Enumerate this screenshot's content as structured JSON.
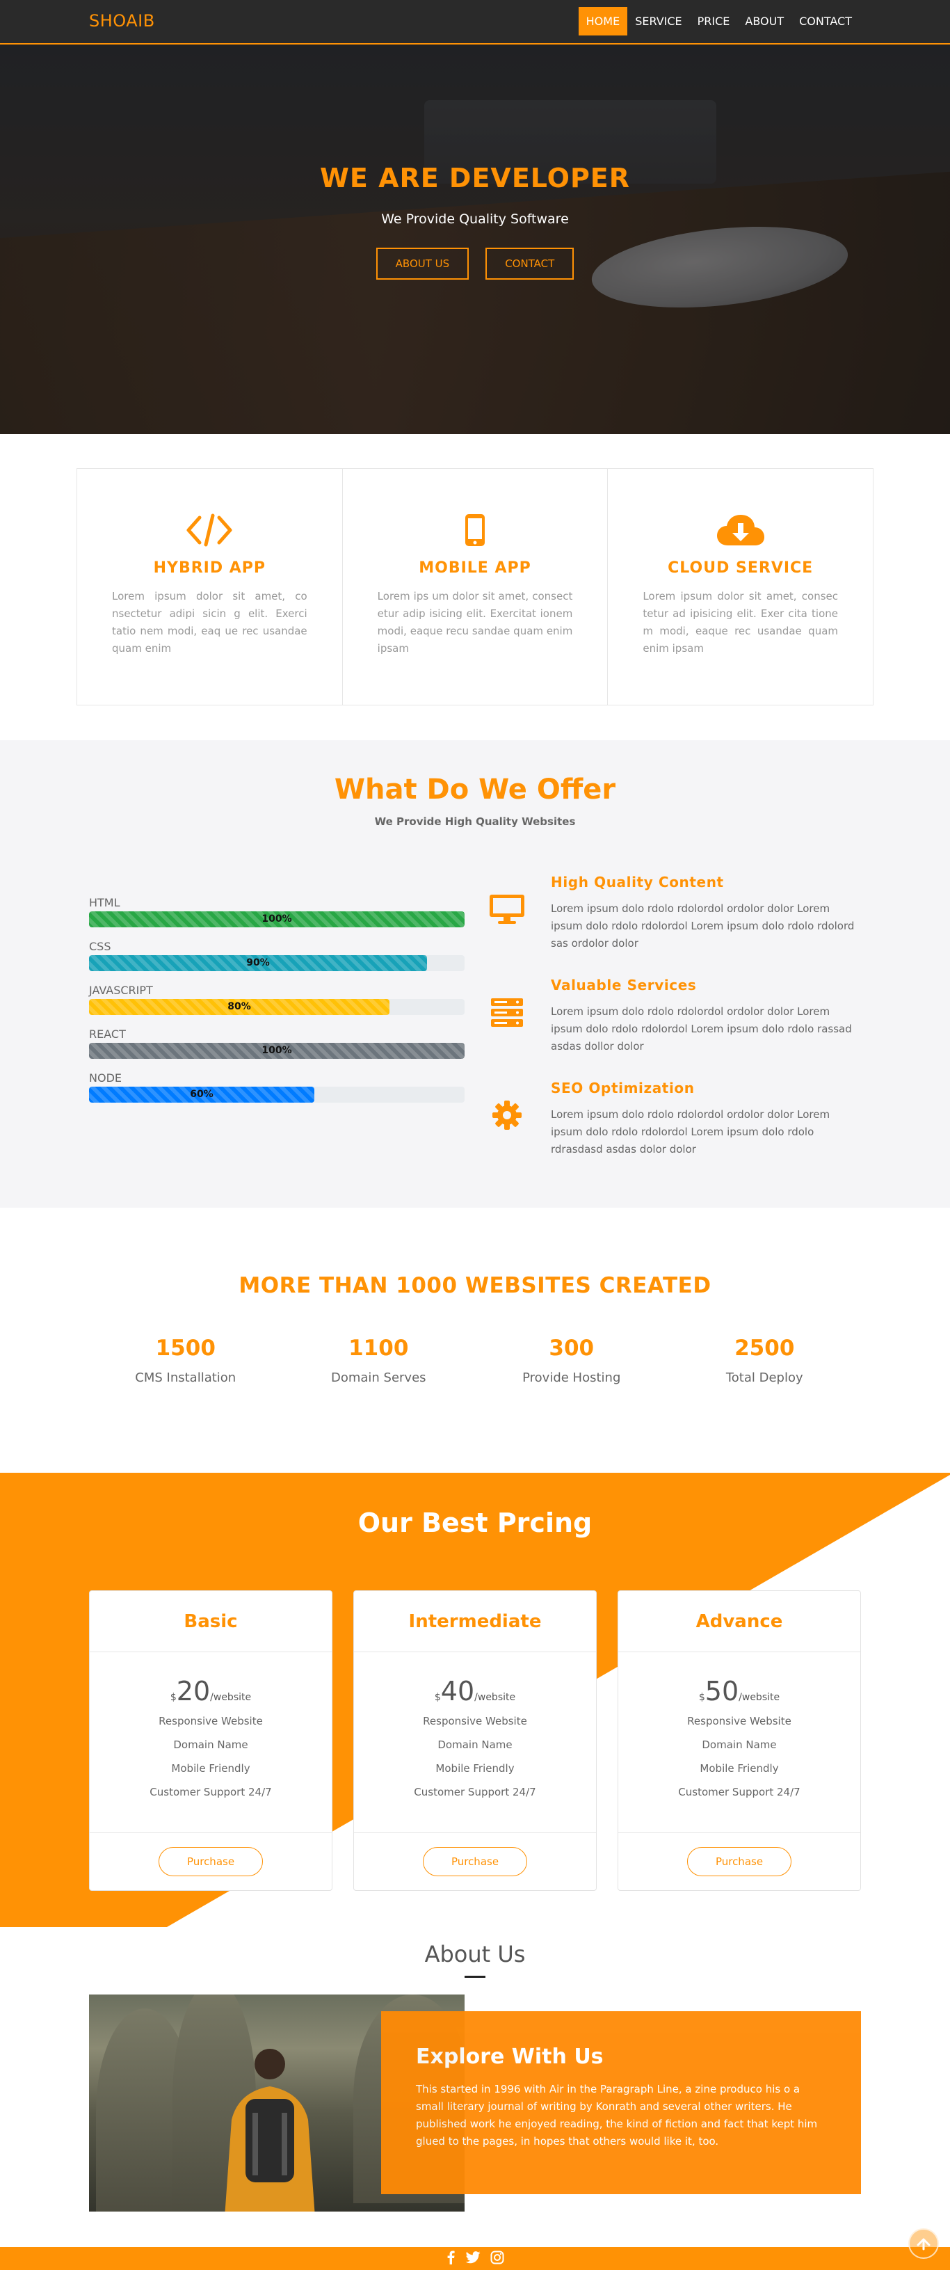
{
  "nav": {
    "brand": "SHOAIB",
    "items": [
      {
        "label": "HOME",
        "active": true
      },
      {
        "label": "SERVICE"
      },
      {
        "label": "PRICE"
      },
      {
        "label": "ABOUT"
      },
      {
        "label": "CONTACT"
      }
    ]
  },
  "hero": {
    "title": "WE ARE DEVELOPER",
    "subtitle": "We Provide Quality Software",
    "about_btn": "ABOUT US",
    "contact_btn": "CONTACT"
  },
  "services": [
    {
      "icon": "code-icon",
      "title": "HYBRID APP",
      "text": "Lorem ipsum dolor sit amet, co nsectetur adipi sicin g elit. Exerci tatio nem modi, eaq ue rec usandae quam enim"
    },
    {
      "icon": "mobile-icon",
      "title": "MOBILE APP",
      "text": "Lorem ips um dolor sit amet, consect etur adip isicing elit. Exercitat ionem modi, eaque recu sandae quam enim ipsam"
    },
    {
      "icon": "cloud-download-icon",
      "title": "CLOUD SERVICE",
      "text": "Lorem ipsum dolor sit amet, consec tetur ad ipisicing elit. Exer cita tione m modi, eaque rec usandae quam enim ipsam"
    }
  ],
  "offer": {
    "title": "What Do We Offer",
    "subtitle": "We Provide High Quality Websites",
    "skills": [
      {
        "name": "HTML",
        "percent": 100,
        "label": "100%",
        "color": "#28a745"
      },
      {
        "name": "CSS",
        "percent": 90,
        "label": "90%",
        "color": "#17a2b8"
      },
      {
        "name": "JAVASCRIPT",
        "percent": 80,
        "label": "80%",
        "color": "#ffc107"
      },
      {
        "name": "REACT",
        "percent": 100,
        "label": "100%",
        "color": "#6c757d"
      },
      {
        "name": "NODE",
        "percent": 60,
        "label": "60%",
        "color": "#007bff"
      }
    ],
    "features": [
      {
        "icon": "monitor-icon",
        "title": "High Quality Content",
        "text": "Lorem ipsum dolo rdolo rdolordol ordolor dolor Lorem ipsum dolo rdolo rdolordol Lorem ipsum dolo rdolo rdolord sas ordolor dolor"
      },
      {
        "icon": "server-icon",
        "title": "Valuable Services",
        "text": "Lorem ipsum dolo rdolo rdolordol ordolor dolor Lorem ipsum dolo rdolo rdolordol Lorem ipsum dolo rdolo rassad asdas dollor dolor"
      },
      {
        "icon": "gear-icon",
        "title": "SEO Optimization",
        "text": "Lorem ipsum dolo rdolo rdolordol ordolor dolor Lorem ipsum dolo rdolo rdolordol Lorem ipsum dolo rdolo rdrasdasd asdas dolor dolor"
      }
    ]
  },
  "stats": {
    "title": "MORE THAN 1000 WEBSITES CREATED",
    "items": [
      {
        "number": "1500",
        "caption": "CMS Installation"
      },
      {
        "number": "1100",
        "caption": "Domain Serves"
      },
      {
        "number": "300",
        "caption": "Provide Hosting"
      },
      {
        "number": "2500",
        "caption": "Total Deploy"
      }
    ]
  },
  "pricing": {
    "title": "Our Best Prcing",
    "plans": [
      {
        "name": "Basic",
        "currency": "$",
        "amount": "20",
        "period": "/website",
        "features": [
          "Responsive Website",
          "Domain Name",
          "Mobile Friendly",
          "Customer Support 24/7"
        ],
        "button": "Purchase"
      },
      {
        "name": "Intermediate",
        "currency": "$",
        "amount": "40",
        "period": "/website",
        "features": [
          "Responsive Website",
          "Domain Name",
          "Mobile Friendly",
          "Customer Support 24/7"
        ],
        "button": "Purchase"
      },
      {
        "name": "Advance",
        "currency": "$",
        "amount": "50",
        "period": "/website",
        "features": [
          "Responsive Website",
          "Domain Name",
          "Mobile Friendly",
          "Customer Support 24/7"
        ],
        "button": "Purchase"
      }
    ]
  },
  "about": {
    "title": "About Us",
    "card_title": "Explore With Us",
    "card_text": "This started in 1996 with Air in the Paragraph Line, a zine produco his o a small literary journal of writing by Konrath and several other writers. He published work he enjoyed reading, the kind of fiction and fact that kept him glued to the pages, in hopes that others would like it, too."
  },
  "footer": {
    "icons": [
      "facebook-icon",
      "twitter-icon",
      "instagram-icon"
    ]
  },
  "colors": {
    "accent": "#ff9205",
    "nav_bg": "#2a2a2a"
  }
}
